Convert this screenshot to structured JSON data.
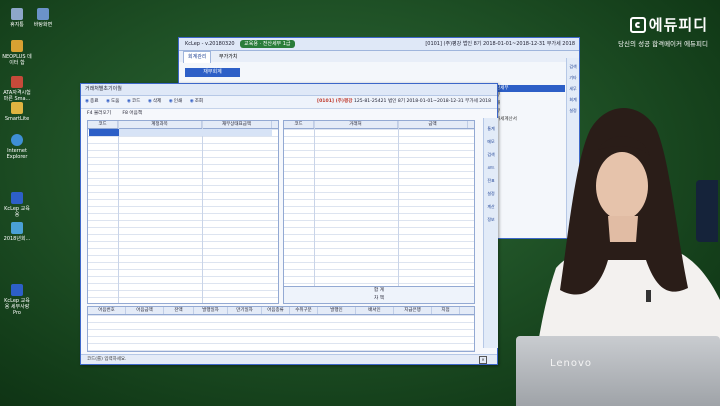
{
  "desktop_icons": [
    {
      "label": "휴지통",
      "color": "#8da7c9"
    },
    {
      "label": "바탕화면",
      "color": "#6b93c9"
    },
    {
      "label": "NEOPLUS 데이터 합",
      "color": "#d8a132"
    },
    {
      "label": "ATA자격시험 마른 Sma...",
      "color": "#c64a3a"
    },
    {
      "label": "SmartLite",
      "color": "#e0b441"
    },
    {
      "label": "Internet Explorer",
      "color": "#3f8fd6"
    },
    {
      "label": "KcLep 교육용",
      "color": "#2d5fc7"
    },
    {
      "label": "2018년회...",
      "color": "#4aa0d6"
    },
    {
      "label": "KcLep 교육용 세무사랑Pro",
      "color": "#2d5fc7"
    }
  ],
  "brand": {
    "name": "에듀피디",
    "tagline": "당신의 성공 합격메이커 에듀피디"
  },
  "back_window": {
    "title": "KcLep - v.20180320",
    "badge": "교육용 · 전산세무 1급",
    "company": "[0101] (주)평강",
    "company_suffix": "법인 8기 2018-01-01~2018-12-31 부가세 2018",
    "tabs": [
      "회계관리",
      "부가가치"
    ],
    "menu_button": "재무회계",
    "side_items": [
      "검색",
      "기타",
      "세무",
      "회계",
      "설정"
    ],
    "list_items": [
      "전산세무",
      "장부",
      "분개",
      "세무",
      "부가세계산서"
    ]
  },
  "front_window": {
    "title": "거래처별초기이월",
    "toolbar": [
      "종료",
      "도움",
      "코드",
      "삭제",
      "인쇄",
      "조회"
    ],
    "company": "[0101] (주)평강",
    "company_suffix": "125-81-25421 법인 8기 2018-01-01~2018-12-31 부가세 2018",
    "sub_toolbar": [
      "F4 불러오기",
      "F8 어음책"
    ],
    "left_headers": [
      "코드",
      "계정과목",
      "재무상태표금액"
    ],
    "right_headers": [
      "코드",
      "거래처",
      "금액"
    ],
    "totals": [
      "합 계",
      "차 액"
    ],
    "bottom_headers": [
      "어음번호",
      "어음금액",
      "잔액",
      "발행일자",
      "만기일자",
      "어음종류",
      "수취구분",
      "발행인",
      "배서인",
      "지급은행",
      "지점"
    ],
    "rail_items": [
      "통계",
      "메모",
      "검색",
      "코드",
      "전표",
      "설정",
      "계산",
      "정보"
    ],
    "status": "코드(를) 입력하세요."
  },
  "laptop_brand": "Lenovo"
}
